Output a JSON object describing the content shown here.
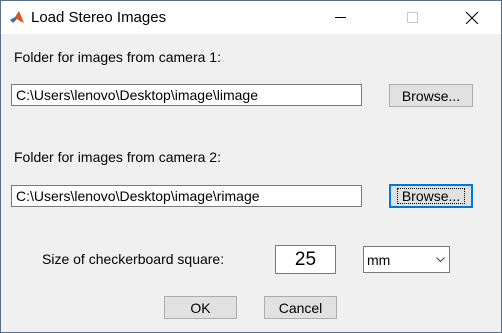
{
  "window": {
    "title": "Load Stereo Images",
    "icon": "matlab-logo-icon"
  },
  "camera1": {
    "label": "Folder for images from camera 1:",
    "path": "C:\\Users\\lenovo\\Desktop\\image\\limage",
    "browse_label": "Browse..."
  },
  "camera2": {
    "label": "Folder for images from camera 2:",
    "path": "C:\\Users\\lenovo\\Desktop\\image\\rimage",
    "browse_label": "Browse..."
  },
  "checkerboard": {
    "label": "Size of checkerboard square:",
    "value": "25",
    "unit": "mm"
  },
  "actions": {
    "ok_label": "OK",
    "cancel_label": "Cancel"
  }
}
